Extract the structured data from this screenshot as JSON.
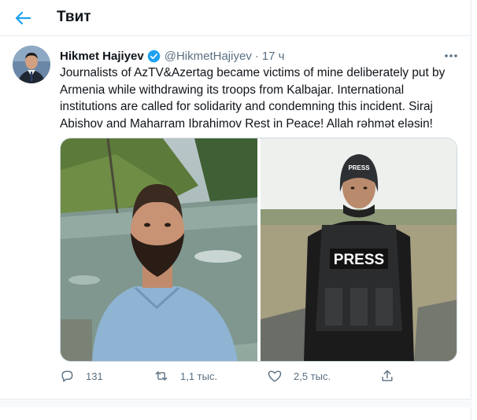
{
  "header": {
    "title": "Твит",
    "back_icon": "arrow-left-icon"
  },
  "tweet": {
    "author_name": "Hikmet Hajiyev",
    "verified": true,
    "handle": "@HikmetHajiyev",
    "separator": "·",
    "time": "17 ч",
    "text": "Journalists of AzTV&Azertag became victims of mine deliberately put by Armenia while withdrawing its troops from Kalbajar. International institutions are called for solidarity and condemning this incident. Siraj Abishov and Maharram Ibrahimov Rest in Peace! Allah rəhmət eləsin!",
    "media": {
      "photos": [
        {
          "alt": "Man in blue shirt by a river"
        },
        {
          "alt": "Journalist in helmet and vest",
          "vest_label": "PRESS",
          "helmet_label": "PRESS"
        }
      ]
    },
    "actions": {
      "replies": "131",
      "retweets": "1,1 тыс.",
      "likes": "2,5 тыс."
    }
  },
  "colors": {
    "accent": "#1da1f2",
    "muted": "#5b7083",
    "border": "#e6ecf0"
  }
}
